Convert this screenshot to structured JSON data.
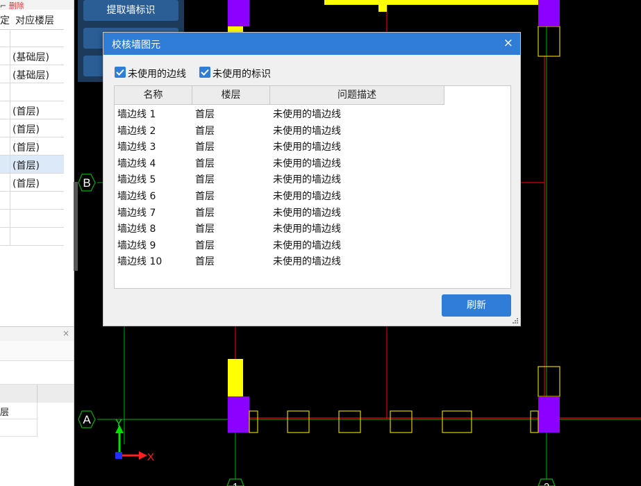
{
  "left_panel": {
    "top_strip_text": "⌐",
    "top_strip_red": "删除",
    "header": {
      "col1": "定",
      "col2": "对应楼层"
    },
    "floor_rows": [
      {
        "label": ""
      },
      {
        "label": "(基础层)"
      },
      {
        "label": "(基础层)"
      },
      {
        "label": ""
      },
      {
        "label": "(首层)"
      },
      {
        "label": "(首层)"
      },
      {
        "label": "(首层)"
      },
      {
        "label": "(首层)"
      },
      {
        "label": "(首层)"
      },
      {
        "label": ""
      },
      {
        "label": ""
      },
      {
        "label": ""
      }
    ],
    "bottom_panel_close": "×",
    "bottom_grid_rows": [
      {
        "label": "层"
      },
      {
        "label": ""
      }
    ]
  },
  "toolbar": {
    "extract_label": "提取墙标识"
  },
  "cad": {
    "axis_b": "B",
    "axis_a": "A",
    "axis_1": "1",
    "axis_2": "2",
    "ucs_y": "Y",
    "ucs_x": "X",
    "colors": {
      "wall": "#ffff00",
      "column": "#8b00ff",
      "axis_line": "#ff0000",
      "grid_line": "#00c000"
    }
  },
  "dialog": {
    "title": "校核墙图元",
    "close_glyph": "×",
    "check_unused_edge": "未使用的边线",
    "check_unused_mark": "未使用的标识",
    "table": {
      "headers": [
        "名称",
        "楼层",
        "问题描述"
      ],
      "rows": [
        {
          "name": "墙边线 1",
          "floor": "首层",
          "desc": "未使用的墙边线"
        },
        {
          "name": "墙边线 2",
          "floor": "首层",
          "desc": "未使用的墙边线"
        },
        {
          "name": "墙边线 3",
          "floor": "首层",
          "desc": "未使用的墙边线"
        },
        {
          "name": "墙边线 4",
          "floor": "首层",
          "desc": "未使用的墙边线"
        },
        {
          "name": "墙边线 5",
          "floor": "首层",
          "desc": "未使用的墙边线"
        },
        {
          "name": "墙边线 6",
          "floor": "首层",
          "desc": "未使用的墙边线"
        },
        {
          "name": "墙边线 7",
          "floor": "首层",
          "desc": "未使用的墙边线"
        },
        {
          "name": "墙边线 8",
          "floor": "首层",
          "desc": "未使用的墙边线"
        },
        {
          "name": "墙边线 9",
          "floor": "首层",
          "desc": "未使用的墙边线"
        },
        {
          "name": "墙边线 10",
          "floor": "首层",
          "desc": "未使用的墙边线"
        }
      ]
    },
    "refresh_label": "刷新"
  }
}
